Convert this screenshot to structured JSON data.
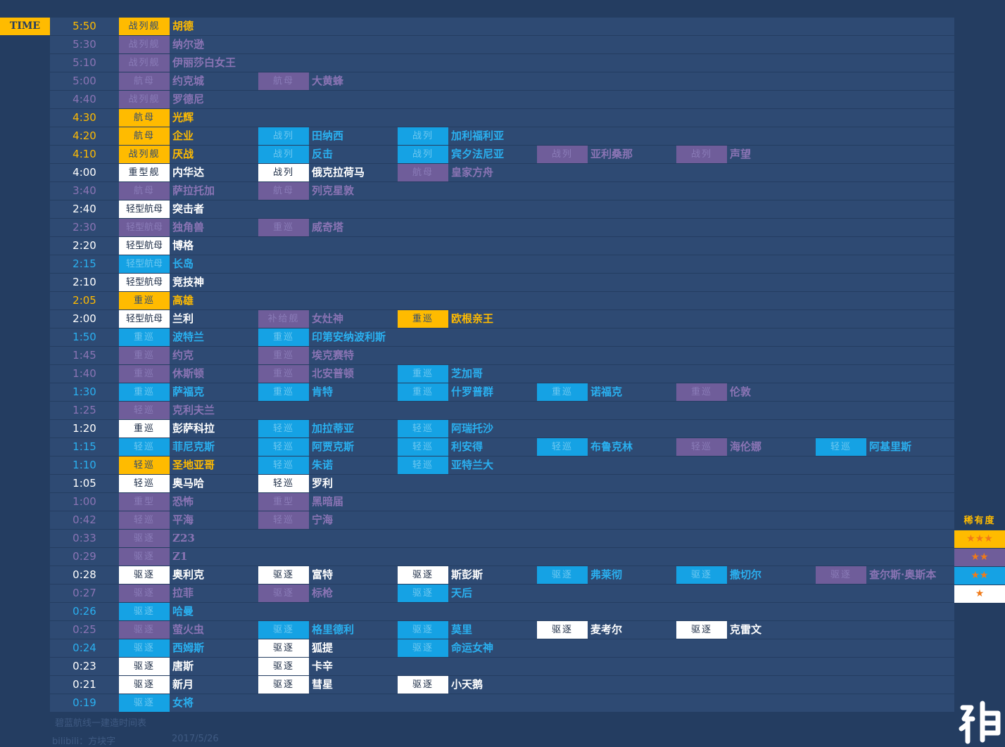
{
  "time_label": "TIME",
  "colors": {
    "bg_outer": "#243d61",
    "bg_main": "#2e4a73",
    "gold": "#ffbb00",
    "purple": "#6f5d9a",
    "blue": "#15a2e4",
    "white": "#ffffff"
  },
  "rows": [
    {
      "time": "5:50",
      "rarity": "gold",
      "entries": [
        {
          "type": "战列舰",
          "rarity": "gold",
          "name": "胡德"
        }
      ]
    },
    {
      "time": "5:30",
      "rarity": "purple",
      "entries": [
        {
          "type": "战列舰",
          "rarity": "purple",
          "name": "纳尔逊"
        }
      ]
    },
    {
      "time": "5:10",
      "rarity": "purple",
      "entries": [
        {
          "type": "战列舰",
          "rarity": "purple",
          "name": "伊丽莎白女王"
        }
      ]
    },
    {
      "time": "5:00",
      "rarity": "purple",
      "entries": [
        {
          "type": "航母",
          "rarity": "purple",
          "name": "约克城"
        },
        {
          "type": "航母",
          "rarity": "purple",
          "name": "大黄蜂"
        }
      ]
    },
    {
      "time": "4:40",
      "rarity": "purple",
      "entries": [
        {
          "type": "战列舰",
          "rarity": "purple",
          "name": "罗德尼"
        }
      ]
    },
    {
      "time": "4:30",
      "rarity": "gold",
      "entries": [
        {
          "type": "航母",
          "rarity": "gold",
          "name": "光辉"
        }
      ]
    },
    {
      "time": "4:20",
      "rarity": "gold",
      "entries": [
        {
          "type": "航母",
          "rarity": "gold",
          "name": "企业"
        },
        {
          "type": "战列",
          "rarity": "blue",
          "name": "田纳西"
        },
        {
          "type": "战列",
          "rarity": "blue",
          "name": "加利福利亚"
        }
      ]
    },
    {
      "time": "4:10",
      "rarity": "gold",
      "entries": [
        {
          "type": "战列舰",
          "rarity": "gold",
          "name": "厌战"
        },
        {
          "type": "战列",
          "rarity": "blue",
          "name": "反击"
        },
        {
          "type": "战列",
          "rarity": "blue",
          "name": "宾夕法尼亚"
        },
        {
          "type": "战列",
          "rarity": "purple",
          "name": "亚利桑那"
        },
        {
          "type": "战列",
          "rarity": "purple",
          "name": "声望"
        }
      ]
    },
    {
      "time": "4:00",
      "rarity": "white",
      "entries": [
        {
          "type": "重型舰",
          "rarity": "white",
          "name": "内华达"
        },
        {
          "type": "战列",
          "rarity": "white",
          "name": "俄克拉荷马"
        },
        {
          "type": "航母",
          "rarity": "purple",
          "name": "皇家方舟"
        }
      ]
    },
    {
      "time": "3:40",
      "rarity": "purple",
      "entries": [
        {
          "type": "航母",
          "rarity": "purple",
          "name": "萨拉托加"
        },
        {
          "type": "航母",
          "rarity": "purple",
          "name": "列克星敦"
        }
      ]
    },
    {
      "time": "2:40",
      "rarity": "white",
      "entries": [
        {
          "type": "轻型航母",
          "rarity": "white",
          "name": "突击者"
        }
      ]
    },
    {
      "time": "2:30",
      "rarity": "purple",
      "entries": [
        {
          "type": "轻型航母",
          "rarity": "purple",
          "name": "独角兽"
        },
        {
          "type": "重巡",
          "rarity": "purple",
          "name": "威奇塔"
        }
      ]
    },
    {
      "time": "2:20",
      "rarity": "white",
      "entries": [
        {
          "type": "轻型航母",
          "rarity": "white",
          "name": "博格"
        }
      ]
    },
    {
      "time": "2:15",
      "rarity": "blue",
      "entries": [
        {
          "type": "轻型航母",
          "rarity": "blue",
          "name": "长岛"
        }
      ]
    },
    {
      "time": "2:10",
      "rarity": "white",
      "entries": [
        {
          "type": "轻型航母",
          "rarity": "white",
          "name": "竞技神"
        }
      ]
    },
    {
      "time": "2:05",
      "rarity": "gold",
      "entries": [
        {
          "type": "重巡",
          "rarity": "gold",
          "name": "高雄"
        }
      ]
    },
    {
      "time": "2:00",
      "rarity": "white",
      "entries": [
        {
          "type": "轻型航母",
          "rarity": "white",
          "name": "兰利"
        },
        {
          "type": "补给舰",
          "rarity": "purple",
          "name": "女灶神"
        },
        {
          "type": "重巡",
          "rarity": "gold",
          "name": "欧根亲王"
        }
      ]
    },
    {
      "time": "1:50",
      "rarity": "blue",
      "entries": [
        {
          "type": "重巡",
          "rarity": "blue",
          "name": "波特兰"
        },
        {
          "type": "重巡",
          "rarity": "blue",
          "name": "印第安纳波利斯"
        }
      ]
    },
    {
      "time": "1:45",
      "rarity": "purple",
      "entries": [
        {
          "type": "重巡",
          "rarity": "purple",
          "name": "约克"
        },
        {
          "type": "重巡",
          "rarity": "purple",
          "name": "埃克赛特"
        }
      ]
    },
    {
      "time": "1:40",
      "rarity": "purple",
      "entries": [
        {
          "type": "重巡",
          "rarity": "purple",
          "name": "休斯顿"
        },
        {
          "type": "重巡",
          "rarity": "purple",
          "name": "北安普顿"
        },
        {
          "type": "重巡",
          "rarity": "blue",
          "name": "芝加哥"
        }
      ]
    },
    {
      "time": "1:30",
      "rarity": "blue",
      "entries": [
        {
          "type": "重巡",
          "rarity": "blue",
          "name": "萨福克"
        },
        {
          "type": "重巡",
          "rarity": "blue",
          "name": "肯特"
        },
        {
          "type": "重巡",
          "rarity": "blue",
          "name": "什罗普群"
        },
        {
          "type": "重巡",
          "rarity": "blue",
          "name": "诺福克"
        },
        {
          "type": "重巡",
          "rarity": "purple",
          "name": "伦敦"
        }
      ]
    },
    {
      "time": "1:25",
      "rarity": "purple",
      "entries": [
        {
          "type": "轻巡",
          "rarity": "purple",
          "name": "克利夫兰"
        }
      ]
    },
    {
      "time": "1:20",
      "rarity": "white",
      "entries": [
        {
          "type": "重巡",
          "rarity": "white",
          "name": "彭萨科拉"
        },
        {
          "type": "轻巡",
          "rarity": "blue",
          "name": "加拉蒂亚"
        },
        {
          "type": "轻巡",
          "rarity": "blue",
          "name": "阿瑞托沙"
        }
      ]
    },
    {
      "time": "1:15",
      "rarity": "blue",
      "entries": [
        {
          "type": "轻巡",
          "rarity": "blue",
          "name": "菲尼克斯"
        },
        {
          "type": "轻巡",
          "rarity": "blue",
          "name": "阿贾克斯"
        },
        {
          "type": "轻巡",
          "rarity": "blue",
          "name": "利安得"
        },
        {
          "type": "轻巡",
          "rarity": "blue",
          "name": "布鲁克林"
        },
        {
          "type": "轻巡",
          "rarity": "purple",
          "name": "海伦娜"
        },
        {
          "type": "轻巡",
          "rarity": "blue",
          "name": "阿基里斯"
        }
      ]
    },
    {
      "time": "1:10",
      "rarity": "blue",
      "entries": [
        {
          "type": "轻巡",
          "rarity": "gold",
          "name": "圣地亚哥"
        },
        {
          "type": "轻巡",
          "rarity": "blue",
          "name": "朱诺"
        },
        {
          "type": "轻巡",
          "rarity": "blue",
          "name": "亚特兰大"
        }
      ]
    },
    {
      "time": "1:05",
      "rarity": "white",
      "entries": [
        {
          "type": "轻巡",
          "rarity": "white",
          "name": "奥马哈"
        },
        {
          "type": "轻巡",
          "rarity": "white",
          "name": "罗利"
        }
      ]
    },
    {
      "time": "1:00",
      "rarity": "purple",
      "entries": [
        {
          "type": "重型",
          "rarity": "purple",
          "name": "恐怖"
        },
        {
          "type": "重型",
          "rarity": "purple",
          "name": "黑暗届"
        }
      ]
    },
    {
      "time": "0:42",
      "rarity": "purple",
      "entries": [
        {
          "type": "轻巡",
          "rarity": "purple",
          "name": "平海"
        },
        {
          "type": "轻巡",
          "rarity": "purple",
          "name": "宁海"
        }
      ]
    },
    {
      "time": "0:33",
      "rarity": "purple",
      "entries": [
        {
          "type": "驱逐",
          "rarity": "purple",
          "name": "Z23"
        }
      ]
    },
    {
      "time": "0:29",
      "rarity": "purple",
      "entries": [
        {
          "type": "驱逐",
          "rarity": "purple",
          "name": "Z1"
        }
      ]
    },
    {
      "time": "0:28",
      "rarity": "white",
      "entries": [
        {
          "type": "驱逐",
          "rarity": "white",
          "name": "奥利克"
        },
        {
          "type": "驱逐",
          "rarity": "white",
          "name": "富特"
        },
        {
          "type": "驱逐",
          "rarity": "white",
          "name": "斯彭斯"
        },
        {
          "type": "驱逐",
          "rarity": "blue",
          "name": "弗莱彻"
        },
        {
          "type": "驱逐",
          "rarity": "blue",
          "name": "撒切尔"
        },
        {
          "type": "驱逐",
          "rarity": "purple",
          "name": "查尔斯·奥斯本"
        }
      ]
    },
    {
      "time": "0:27",
      "rarity": "purple",
      "entries": [
        {
          "type": "驱逐",
          "rarity": "purple",
          "name": "拉菲"
        },
        {
          "type": "驱逐",
          "rarity": "purple",
          "name": "标枪"
        },
        {
          "type": "驱逐",
          "rarity": "blue",
          "name": "天后"
        }
      ]
    },
    {
      "time": "0:26",
      "rarity": "blue",
      "entries": [
        {
          "type": "驱逐",
          "rarity": "blue",
          "name": "哈曼"
        }
      ]
    },
    {
      "time": "0:25",
      "rarity": "purple",
      "entries": [
        {
          "type": "驱逐",
          "rarity": "purple",
          "name": "萤火虫"
        },
        {
          "type": "驱逐",
          "rarity": "blue",
          "name": "格里德利"
        },
        {
          "type": "驱逐",
          "rarity": "blue",
          "name": "莫里"
        },
        {
          "type": "驱逐",
          "rarity": "white",
          "name": "麦考尔"
        },
        {
          "type": "驱逐",
          "rarity": "white",
          "name": "克雷文"
        }
      ]
    },
    {
      "time": "0:24",
      "rarity": "blue",
      "entries": [
        {
          "type": "驱逐",
          "rarity": "blue",
          "name": "西姆斯"
        },
        {
          "type": "驱逐",
          "rarity": "white",
          "name": "狐提"
        },
        {
          "type": "驱逐",
          "rarity": "blue",
          "name": "命运女神"
        }
      ]
    },
    {
      "time": "0:23",
      "rarity": "white",
      "entries": [
        {
          "type": "驱逐",
          "rarity": "white",
          "name": "唐斯"
        },
        {
          "type": "驱逐",
          "rarity": "white",
          "name": "卡辛"
        }
      ]
    },
    {
      "time": "0:21",
      "rarity": "white",
      "entries": [
        {
          "type": "驱逐",
          "rarity": "white",
          "name": "新月"
        },
        {
          "type": "驱逐",
          "rarity": "white",
          "name": "彗星"
        },
        {
          "type": "驱逐",
          "rarity": "white",
          "name": "小天鹅"
        }
      ]
    },
    {
      "time": "0:19",
      "rarity": "blue",
      "entries": [
        {
          "type": "驱逐",
          "rarity": "blue",
          "name": "女将"
        }
      ]
    }
  ],
  "legend": {
    "title": "稀有度",
    "items": [
      {
        "stars": "★★★",
        "rarity": "gold"
      },
      {
        "stars": "★★",
        "rarity": "purple"
      },
      {
        "stars": "★★",
        "rarity": "blue"
      },
      {
        "stars": "★",
        "rarity": "white"
      }
    ]
  },
  "footer": {
    "title": "碧蓝航线一建造时间表",
    "author": "bilibili：方块字",
    "date": "2017/5/26"
  }
}
